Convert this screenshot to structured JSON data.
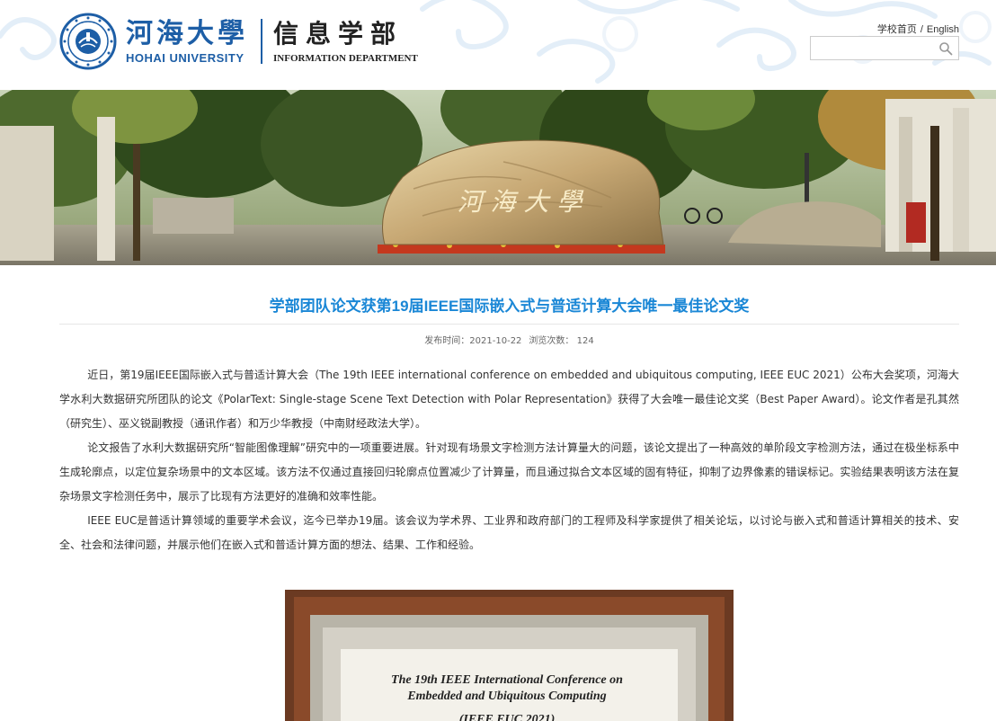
{
  "header": {
    "school_name_cn": "河海大學",
    "school_name_en": "HOHAI UNIVERSITY",
    "dept_name_cn": "信息学部",
    "dept_name_en": "INFORMATION DEPARTMENT",
    "home_link": "学校首页",
    "separator": "/",
    "english_link": "English",
    "search_placeholder": ""
  },
  "banner": {
    "rock_inscription": "河 海 大 學"
  },
  "article": {
    "title": "学部团队论文获第19届IEEE国际嵌入式与普适计算大会唯一最佳论文奖",
    "publish_label": "发布时间：",
    "publish_date": "2021-10-22",
    "views_label": "浏览次数：",
    "views": "124",
    "p1": "近日，第19届IEEE国际嵌入式与普适计算大会（The 19th IEEE international conference on embedded and ubiquitous computing, IEEE EUC 2021）公布大会奖项，河海大学水利大数据研究所团队的论文《PolarText: Single-stage Scene Text Detection with Polar Representation》获得了大会唯一最佳论文奖（Best Paper Award）。论文作者是孔其然（研究生）、巫义锐副教授（通讯作者）和万少华教授（中南财经政法大学）。",
    "p2": "论文报告了水利大数据研究所“智能图像理解”研究中的一项重要进展。针对现有场景文字检测方法计算量大的问题，该论文提出了一种高效的单阶段文字检测方法，通过在极坐标系中生成轮廓点，以定位复杂场景中的文本区域。该方法不仅通过直接回归轮廓点位置减少了计算量，而且通过拟合文本区域的固有特征，抑制了边界像素的错误标记。实验结果表明该方法在复杂场景文字检测任务中，展示了比现有方法更好的准确和效率性能。",
    "p3": "IEEE EUC是普适计算领域的重要学术会议，迄今已举办19届。该会议为学术界、工业界和政府部门的工程师及科学家提供了相关论坛，以讨论与嵌入式和普适计算相关的技术、安全、社会和法律问题，并展示他们在嵌入式和普适计算方面的想法、结果、工作和经验。"
  },
  "certificate": {
    "line1": "The 19th IEEE International Conference on",
    "line2": "Embedded and Ubiquitous Computing",
    "line3": "(IEEE EUC 2021)"
  },
  "colors": {
    "brand_blue": "#1d5ea6",
    "title_blue": "#1a87d6"
  }
}
